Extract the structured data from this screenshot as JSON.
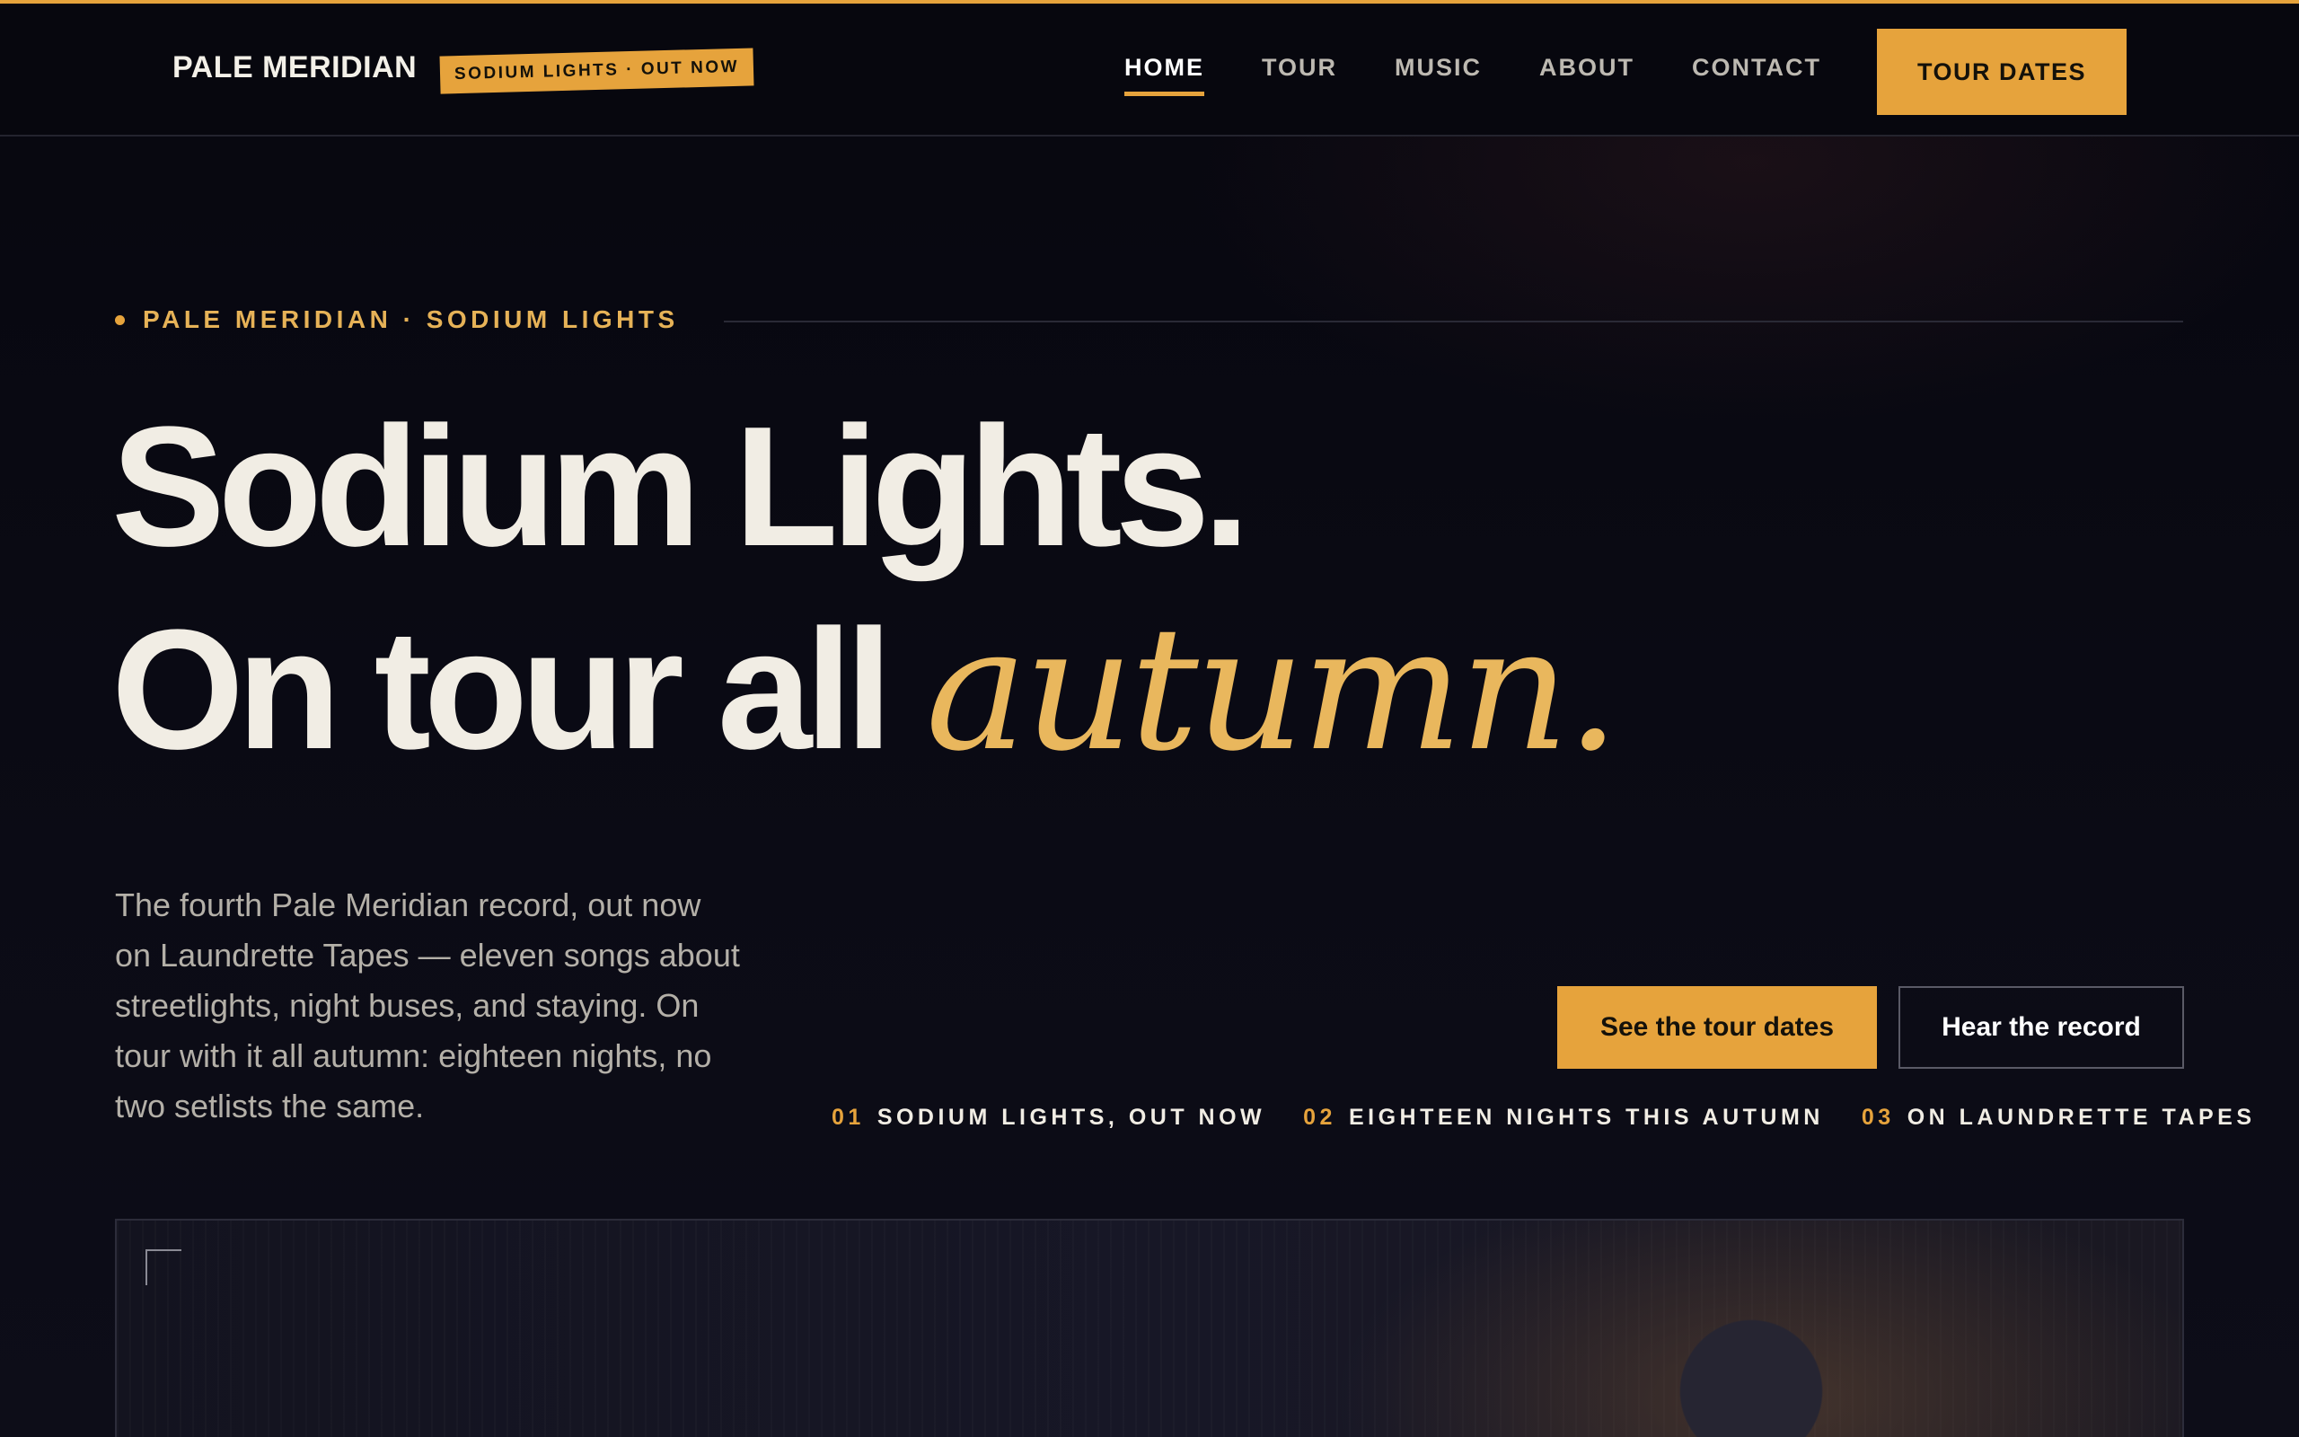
{
  "header": {
    "brand": "PALE MERIDIAN",
    "tag": "SODIUM LIGHTS · OUT NOW",
    "nav": [
      {
        "label": "HOME",
        "active": true
      },
      {
        "label": "TOUR"
      },
      {
        "label": "MUSIC"
      },
      {
        "label": "ABOUT"
      },
      {
        "label": "CONTACT"
      }
    ],
    "cta": "TOUR DATES"
  },
  "hero": {
    "eyebrow": "PALE MERIDIAN · SODIUM LIGHTS",
    "headline_line1": "Sodium Lights.",
    "headline_line2": "On tour all",
    "headline_accent": "autumn.",
    "intro": "The fourth Pale Meridian record, out now on Laundrette Tapes — eleven songs about streetlights, night buses, and staying. On tour with it all autumn: eighteen nights, no two setlists the same.",
    "primary_button": "See the tour dates",
    "secondary_button": "Hear the record",
    "facts": [
      {
        "num": "01",
        "text": "SODIUM LIGHTS, OUT NOW"
      },
      {
        "num": "02",
        "text": "EIGHTEEN NIGHTS THIS AUTUMN"
      },
      {
        "num": "03",
        "text": "ON LAUNDRETTE TAPES"
      }
    ]
  },
  "colors": {
    "accent": "#e6a33c",
    "background": "#0b0b14",
    "text": "#f1ede4"
  }
}
